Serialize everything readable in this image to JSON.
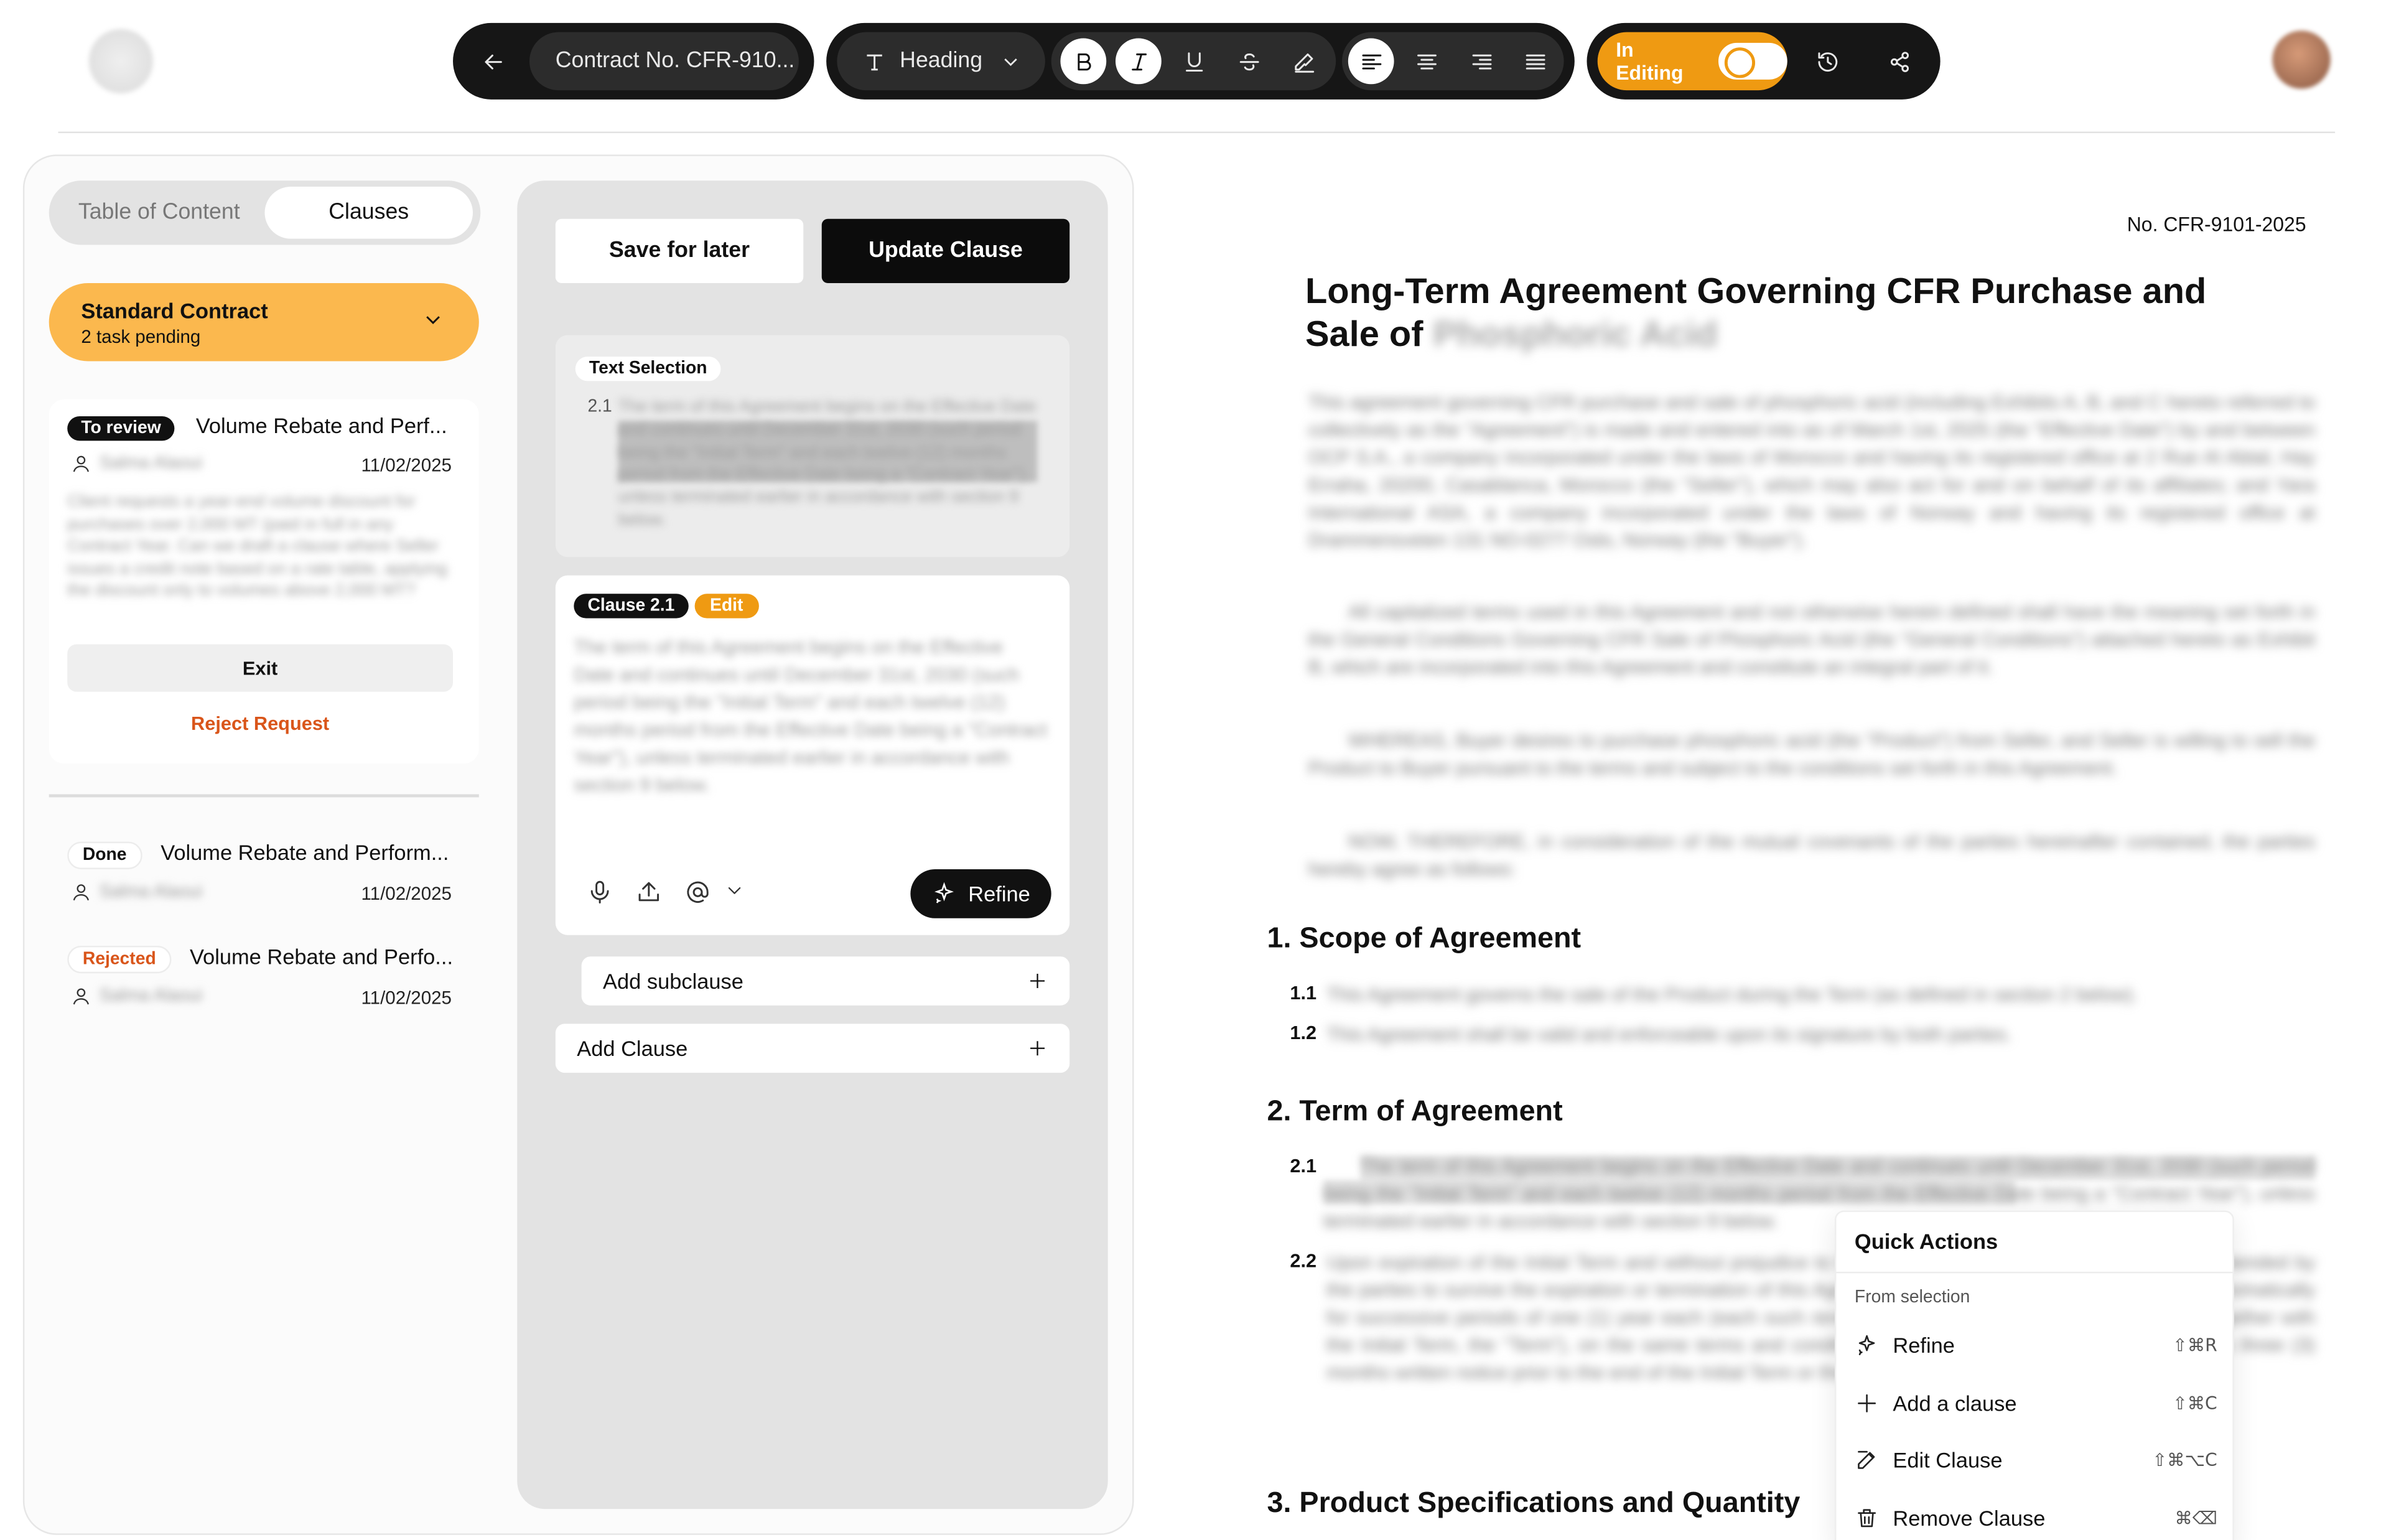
{
  "toolbar": {
    "back_icon": "arrow-left-icon",
    "doc_title": "Contract No. CFR-910...",
    "text_style_icon": "text-type-icon",
    "text_style": "Heading",
    "format_icons": [
      "bold-icon",
      "italic-icon",
      "underline-icon",
      "strikethrough-icon",
      "highlighter-icon"
    ],
    "align_icons": [
      "align-left-icon",
      "align-center-icon",
      "align-right-icon",
      "align-justify-icon"
    ],
    "editing_label": "In Editing",
    "history_icon": "history-icon",
    "share_icon": "share-icon",
    "accent_color": "#ef9a12"
  },
  "sidebar": {
    "tabs": [
      {
        "label": "Table of Content",
        "active": false
      },
      {
        "label": "Clauses",
        "active": true
      }
    ],
    "contract": {
      "title": "Standard Contract",
      "subtitle": "2 task pending",
      "color": "#fbb84e"
    },
    "review_card": {
      "badge": "To review",
      "title": "Volume Rebate and Perf...",
      "user": "Salma Alaoui",
      "date": "11/02/2025",
      "description": "Client requests a year-end volume discount for purchases over 2,000 MT (paid in full in any Contract Year. Can we draft a clause where Seller issues a credit note based on a rate table, applying the discount only to volumes above 2,000 MT?",
      "exit_label": "Exit",
      "reject_label": "Reject Request"
    },
    "items": [
      {
        "badge": "Done",
        "title": "Volume Rebate and Perform...",
        "user": "Salma Alaoui",
        "date": "11/02/2025"
      },
      {
        "badge": "Rejected",
        "title": "Volume Rebate and Perfo...",
        "user": "Salma Alaoui",
        "date": "11/02/2025"
      }
    ]
  },
  "editor": {
    "save_label": "Save for later",
    "update_label": "Update Clause",
    "selection": {
      "tag": "Text Selection",
      "number": "2.1",
      "text": "The term of this Agreement begins on the Effective Date and continues until December 31st, 2030 (such period being the \"Initial Term\" and each twelve (12) months period from the Effective Date being a \"Contract Year\"), unless terminated earlier in accordance with section 9 below."
    },
    "clause": {
      "tag": "Clause 2.1",
      "edit_tag": "Edit",
      "text": "The term of this Agreement begins on the Effective Date and continues until December 31st, 2030 (such period being the \"Initial Term\" and each twelve (12) months period from the Effective Date being a \"Contract Year\"), unless terminated earlier in accordance with section 9 below.",
      "tool_icons": [
        "microphone-icon",
        "upload-icon",
        "at-sign-icon",
        "chevron-down-icon"
      ],
      "refine_label": "Refine"
    },
    "add_subclause_label": "Add subclause",
    "add_clause_label": "Add Clause"
  },
  "document": {
    "number": "No. CFR-9101-2025",
    "title_line1": "Long-Term Agreement Governing CFR Purchase and",
    "title_line2_prefix": "Sale of",
    "title_line2_redacted": "Phosphoric Acid",
    "intro_paragraphs": [
      "This agreement governing CFR purchase and sale of phosphoric acid (including Exhibits A, B, and C hereto referred to collectively as the \"Agreement\") is made and entered into as of March 1st, 2025 (the \"Effective Date\") by and between OCP S.A., a company incorporated under the laws of Morocco and having its registered office at 2 Rue Al Abtal, Hay Erraha, 20200, Casablanca, Morocco (the \"Seller\"), which may also act for and on behalf of its affiliates; and Yara International ASA, a company incorporated under the laws of Norway and having its registered office at Drammensveien 131 NO-0277 Oslo, Norway (the \"Buyer\").",
      "All capitalized terms used in this Agreement and not otherwise herein defined shall have the meaning set forth in the General Conditions Governing CFR Sale of Phosphoric Acid (the \"General Conditions\") attached hereto as Exhibit B, which are incorporated into this Agreement and constitute an integral part of it.",
      "WHEREAS, Buyer desires to purchase phosphoric acid (the \"Product\") from Seller, and Seller is willing to sell the Product to Buyer pursuant to the terms and subject to the conditions set forth in this Agreement.",
      "NOW, THEREFORE, in consideration of the mutual covenants of the parties hereinafter contained, the parties hereby agree as follows:"
    ],
    "sections": [
      {
        "heading": "1. Scope of Agreement",
        "clauses": [
          {
            "num": "1.1",
            "text": "This Agreement governs the sale of the Product during the Term (as defined in section 2 below)."
          },
          {
            "num": "1.2",
            "text": "This Agreement shall be valid and enforceable upon its signature by both parties."
          }
        ]
      },
      {
        "heading": "2. Term of Agreement",
        "clauses": [
          {
            "num": "2.1",
            "text": "The term of this Agreement begins on the Effective Date and continues until December 31st, 2030 (such period being the \"Initial Term\" and each twelve (12) months period from the Effective Date being a \"Contract Year\"), unless terminated earlier in accordance with section 9 below."
          },
          {
            "num": "2.2",
            "text": "Upon expiration of the Initial Term and without prejudice to those provisions of this Agreement that are intended by the parties to survive the expiration or termination of this Agreement, this Agreement shall be renewed automatically for successive periods of one (1) year each (each such renewal period being a \"Renewal Term\", and together with the Initial Term, the \"Term\"), on the same terms and conditions unless terminated by either party with a three (3) months written notice prior to the end of the Initial Term or then applicable Renewal Term."
          }
        ]
      },
      {
        "heading": "3. Product Specifications and Quantity",
        "clauses": []
      }
    ]
  },
  "quick_actions": {
    "title": "Quick Actions",
    "subtitle": "From selection",
    "items": [
      {
        "icon": "sparkle-icon",
        "label": "Refine",
        "shortcut": "⇧⌘R"
      },
      {
        "icon": "plus-icon",
        "label": "Add a clause",
        "shortcut": "⇧⌘C"
      },
      {
        "icon": "edit-icon",
        "label": "Edit Clause",
        "shortcut": "⇧⌘⌥C"
      },
      {
        "icon": "trash-icon",
        "label": "Remove Clause",
        "shortcut": "⌘⌫"
      }
    ]
  }
}
